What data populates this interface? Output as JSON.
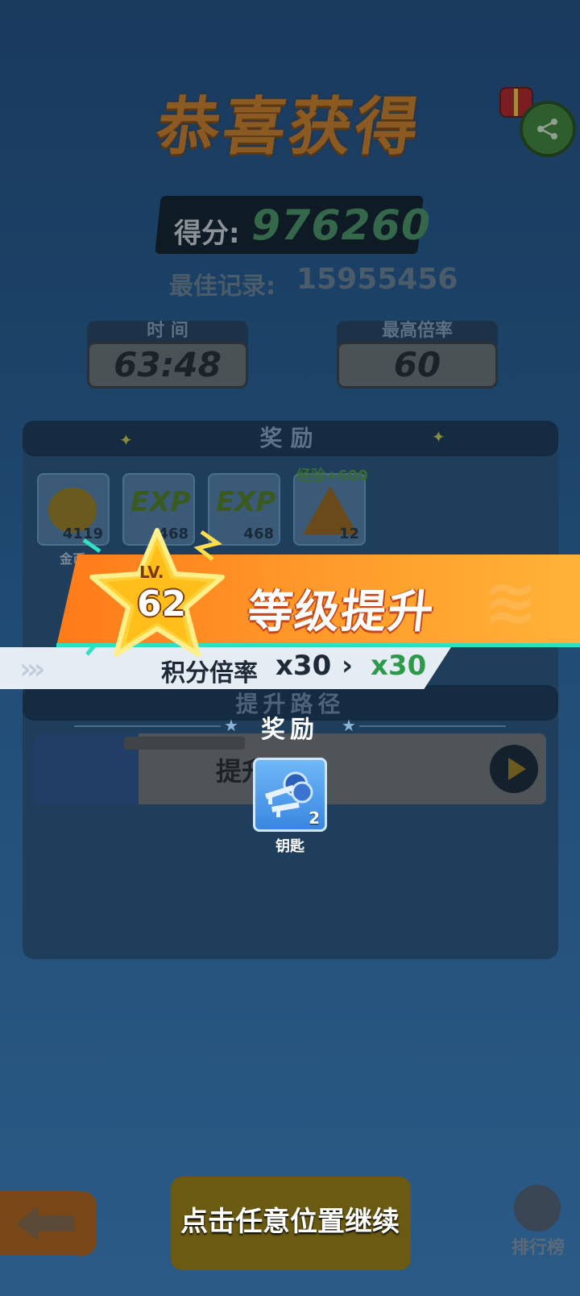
{
  "result": {
    "title": "恭喜获得",
    "score_label": "得分:",
    "score_value": "976260",
    "best_label": "最佳记录:",
    "best_value": "15955456",
    "stats": [
      {
        "label": "时 间",
        "value": "63:48"
      },
      {
        "label": "最高倍率",
        "value": "60"
      }
    ],
    "rewards_title": "奖励",
    "reward_cards": [
      {
        "icon": "coin-bag-icon",
        "count": "4119",
        "caption": "金币"
      },
      {
        "icon": "exp-icon",
        "count": "468",
        "art": "EXP"
      },
      {
        "icon": "exp-icon",
        "count": "468",
        "art": "EXP"
      },
      {
        "icon": "pyramid-icon",
        "count": "12",
        "badge": "经验+600"
      }
    ],
    "path_title": "提升路径",
    "path_row_label": "提升能力"
  },
  "levelup": {
    "lv_label": "LV.",
    "level": "62",
    "title": "等级提升",
    "multiplier_label": "积分倍率",
    "multiplier_old": "x30",
    "arrow": "›",
    "multiplier_new": "x30",
    "chevrons": "›››",
    "reward_title": "奖励",
    "reward_item": {
      "icon": "keys-icon",
      "count": "2",
      "caption": "钥匙"
    }
  },
  "footer": {
    "continue_text": "点击任意位置继续",
    "rank_label": "排行榜"
  },
  "colors": {
    "band_orange": "#ff8a22",
    "multiplier_new": "#2d9a4a",
    "star_gold": "#ffd23a"
  }
}
